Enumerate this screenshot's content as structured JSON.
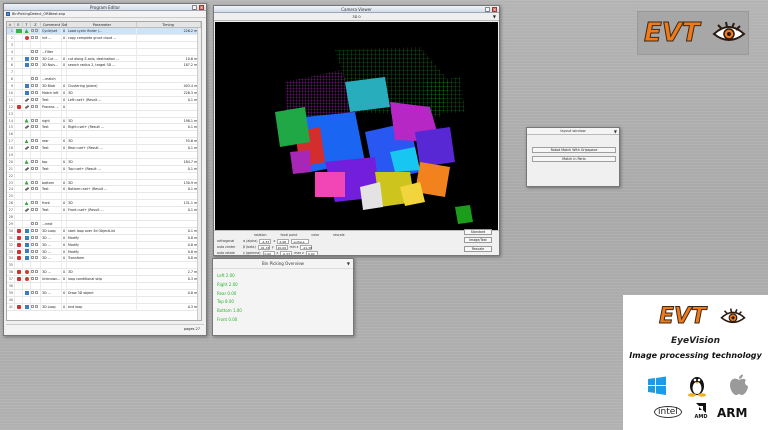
{
  "program_editor": {
    "title": "Program Editor",
    "filename": "BinPickingDetect_ORBtest.evp",
    "columns": [
      "#",
      "E",
      "T",
      "Z",
      "B",
      "C",
      "Comment",
      "Sel",
      "Parameter",
      "Timing"
    ],
    "rows": [
      {
        "n": "1",
        "flag": "green",
        "icon": "green",
        "cmt": "Cycle/set",
        "sel": "0",
        "par": "Load cyclic finder /...",
        "tim": "226.2 ms",
        "selected": true
      },
      {
        "n": "2",
        "flag": "",
        "icon": "red",
        "cmt": "Init ...",
        "sel": "0",
        "par": "copy complete grunt cloud ...",
        "tim": ""
      },
      {
        "n": "3",
        "flag": "",
        "icon": "",
        "cmt": "",
        "sel": "",
        "par": "",
        "tim": ""
      },
      {
        "n": "4",
        "flag": "",
        "icon": "",
        "cmt": "...Filter",
        "sel": "",
        "par": "",
        "tim": ""
      },
      {
        "n": "5",
        "flag": "",
        "icon": "cube",
        "cmt": "3D Cut ...",
        "sel": "0",
        "par": "cut along Z-axis, destination ...",
        "tim": "10.6 ms"
      },
      {
        "n": "6",
        "flag": "",
        "icon": "cube",
        "cmt": "3D Nois...",
        "sel": "0",
        "par": "search radius 2, target 3D ...",
        "tim": "187.2 ms"
      },
      {
        "n": "7",
        "flag": "",
        "icon": "",
        "cmt": "",
        "sel": "",
        "par": "",
        "tim": ""
      },
      {
        "n": "8",
        "flag": "",
        "icon": "",
        "cmt": "...match",
        "sel": "",
        "par": "",
        "tim": ""
      },
      {
        "n": "9",
        "flag": "",
        "icon": "cube",
        "cmt": "3D Blob",
        "sel": "0",
        "par": "Clustering (plane)",
        "tim": "403.4 ms"
      },
      {
        "n": "10",
        "flag": "",
        "icon": "cube",
        "cmt": "Match left",
        "sel": "0",
        "par": "3D",
        "tim": "226.3 ms"
      },
      {
        "n": "11",
        "flag": "",
        "icon": "pen",
        "cmt": "Text",
        "sel": "0",
        "par": "Left=set+ (Result ...",
        "tim": "0.1 ms"
      },
      {
        "n": "12",
        "flag": "red",
        "icon": "pen",
        "cmt": "Process ...",
        "sel": "0",
        "par": "",
        "tim": ""
      },
      {
        "n": "13",
        "flag": "",
        "icon": "",
        "cmt": "",
        "sel": "",
        "par": "",
        "tim": ""
      },
      {
        "n": "14",
        "flag": "",
        "icon": "green",
        "cmt": "right",
        "sel": "0",
        "par": "3D",
        "tim": "198.1 ms"
      },
      {
        "n": "15",
        "flag": "",
        "icon": "pen",
        "cmt": "Text",
        "sel": "0",
        "par": "Right=set+ (Result ...",
        "tim": "0.1 ms"
      },
      {
        "n": "16",
        "flag": "",
        "icon": "",
        "cmt": "",
        "sel": "",
        "par": "",
        "tim": ""
      },
      {
        "n": "17",
        "flag": "",
        "icon": "green",
        "cmt": "rear",
        "sel": "0",
        "par": "3D",
        "tim": "55.6 ms"
      },
      {
        "n": "18",
        "flag": "",
        "icon": "pen",
        "cmt": "Text",
        "sel": "0",
        "par": "Rear=set+ (Result ...",
        "tim": "0.1 ms"
      },
      {
        "n": "19",
        "flag": "",
        "icon": "",
        "cmt": "",
        "sel": "",
        "par": "",
        "tim": ""
      },
      {
        "n": "20",
        "flag": "",
        "icon": "green",
        "cmt": "top",
        "sel": "0",
        "par": "3D",
        "tim": "184.7 ms"
      },
      {
        "n": "21",
        "flag": "",
        "icon": "pen",
        "cmt": "Text",
        "sel": "0",
        "par": "Top=set+ (Result ...",
        "tim": "0.1 ms"
      },
      {
        "n": "22",
        "flag": "",
        "icon": "",
        "cmt": "",
        "sel": "",
        "par": "",
        "tim": ""
      },
      {
        "n": "23",
        "flag": "",
        "icon": "green",
        "cmt": "bottom",
        "sel": "0",
        "par": "3D",
        "tim": "130.9 ms"
      },
      {
        "n": "24",
        "flag": "",
        "icon": "pen",
        "cmt": "Text",
        "sel": "0",
        "par": "Bottom=set+ (Result ...",
        "tim": "0.1 ms"
      },
      {
        "n": "25",
        "flag": "",
        "icon": "",
        "cmt": "",
        "sel": "",
        "par": "",
        "tim": ""
      },
      {
        "n": "26",
        "flag": "",
        "icon": "green",
        "cmt": "front",
        "sel": "0",
        "par": "3D",
        "tim": "131.1 ms"
      },
      {
        "n": "27",
        "flag": "",
        "icon": "pen",
        "cmt": "Text",
        "sel": "0",
        "par": "Front=set+ (Result ...",
        "tim": "0.1 ms"
      },
      {
        "n": "28",
        "flag": "",
        "icon": "",
        "cmt": "",
        "sel": "",
        "par": "",
        "tim": ""
      },
      {
        "n": "29",
        "flag": "",
        "icon": "",
        "cmt": "...next",
        "sel": "",
        "par": "",
        "tim": ""
      },
      {
        "n": "30",
        "flag": "red",
        "icon": "cube",
        "cmt": "3D Loop",
        "sel": "0",
        "par": "start loop over 3d ObjectList",
        "tim": "0.1 ms"
      },
      {
        "n": "31",
        "flag": "red",
        "icon": "cube",
        "cmt": "3D ...",
        "sel": "0",
        "par": "Modify",
        "tim": "0.8 ms"
      },
      {
        "n": "32",
        "flag": "red",
        "icon": "cube",
        "cmt": "3D ...",
        "sel": "0",
        "par": "Modify",
        "tim": "0.8 ms"
      },
      {
        "n": "33",
        "flag": "red",
        "icon": "cube",
        "cmt": "3D ...",
        "sel": "0",
        "par": "Modify",
        "tim": "0.8 ms"
      },
      {
        "n": "34",
        "flag": "red",
        "icon": "cube",
        "cmt": "3D ...",
        "sel": "0",
        "par": "Transform",
        "tim": "0.8 ms"
      },
      {
        "n": "35",
        "flag": "",
        "icon": "",
        "cmt": "",
        "sel": "",
        "par": "",
        "tim": ""
      },
      {
        "n": "36",
        "flag": "red",
        "icon": "red",
        "cmt": "3D ...",
        "sel": "0",
        "par": "3D",
        "tim": "2.7 ms"
      },
      {
        "n": "37",
        "flag": "red",
        "icon": "red",
        "cmt": "Unknown...",
        "sel": "0",
        "par": "loop conditional skip",
        "tim": "0.3 ms"
      },
      {
        "n": "38",
        "flag": "",
        "icon": "",
        "cmt": "",
        "sel": "",
        "par": "",
        "tim": ""
      },
      {
        "n": "39",
        "flag": "",
        "icon": "cube",
        "cmt": "3D ...",
        "sel": "0",
        "par": "Draw 3D object",
        "tim": "0.8 ms"
      },
      {
        "n": "40",
        "flag": "",
        "icon": "",
        "cmt": "",
        "sel": "",
        "par": "",
        "tim": ""
      },
      {
        "n": "41",
        "flag": "red",
        "icon": "cube",
        "cmt": "3D Loop",
        "sel": "0",
        "par": "end loop",
        "tim": "0.3 ms"
      }
    ],
    "status": "pages 27"
  },
  "camera_viewer": {
    "title": "Camera Viewer",
    "sub": "3D 0",
    "labels": {
      "rotation": "rotation",
      "focal": "focal point",
      "color": "color",
      "rescale": "rescale",
      "orthogonal": "orthogonal",
      "auto_center": "auto center",
      "auto_rotate": "auto rotate"
    },
    "fields": {
      "x_alpha_label": "α (alpha)",
      "x_alpha": "-4,33",
      "y_beta_label": "β (beta)",
      "y_beta": "-91,33",
      "z_gamma_label": "γ (gamma)",
      "z_gamma": "0,00",
      "fx_label": "x",
      "fx": "2,98",
      "fy_label": "y",
      "fy": "20,00",
      "fz_label": "z",
      "fz": "-0,33",
      "color_mode": "surface",
      "min_label": "min z",
      "min_z": "-22,38",
      "max_label": "max z",
      "max_z": "0,00"
    },
    "buttons": {
      "standard": "Standard",
      "image": "Image/Text",
      "rescale": "Rescale"
    }
  },
  "bin_overview": {
    "title": "Bin Picking Overview",
    "lines": [
      "Left 2.00",
      "Right 2.00",
      "Rear 0.00",
      "Top 8.00",
      "Bottom 1.00",
      "Front 0.00"
    ]
  },
  "layout_window": {
    "title": "layout window",
    "buttons": [
      "Robot Match With Gripspace",
      "Match in Parts"
    ]
  },
  "logo_top": {
    "text": "EVT"
  },
  "brand": {
    "logo": "EVT",
    "product": "EyeVision",
    "tagline": "Image processing technology",
    "platforms": [
      "windows-icon",
      "linux-icon",
      "apple-icon",
      "intel-icon",
      "amd-icon",
      "arm-icon"
    ],
    "intel": "intel",
    "amd": "AMD",
    "arm": "ARM"
  },
  "colors": {
    "accent": "#f07a1a",
    "bin_text": "#27b327"
  }
}
